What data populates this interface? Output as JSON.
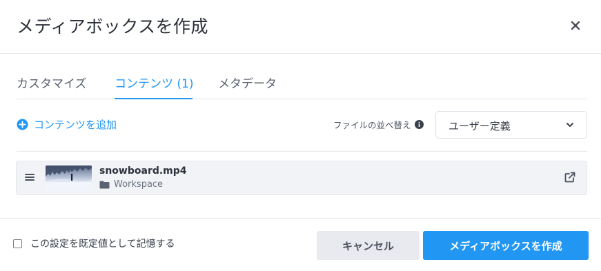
{
  "dialog": {
    "title": "メディアボックスを作成"
  },
  "tabs": [
    {
      "label": "カスタマイズ",
      "active": false
    },
    {
      "label": "コンテンツ (1)",
      "active": true
    },
    {
      "label": "メタデータ",
      "active": false
    }
  ],
  "toolbar": {
    "add_content_label": "コンテンツを追加",
    "sort_label": "ファイルの並べ替え",
    "sort_value": "ユーザー定義"
  },
  "contents": [
    {
      "filename": "snowboard.mp4",
      "location": "Workspace"
    }
  ],
  "footer": {
    "remember_label": "この設定を既定値として記憶する",
    "remember_checked": false,
    "cancel_label": "キャンセル",
    "create_label": "メディアボックスを作成"
  },
  "icons": {
    "close": "close-icon",
    "add": "plus-circle-icon",
    "info": "info-icon",
    "dropdown": "chevron-down-icon",
    "drag": "drag-handle-icon",
    "folder": "folder-icon",
    "open": "external-link-icon"
  },
  "colors": {
    "accent": "#2196f3",
    "cancel_bg": "#e9eaef",
    "item_bg": "#f2f3f6"
  }
}
